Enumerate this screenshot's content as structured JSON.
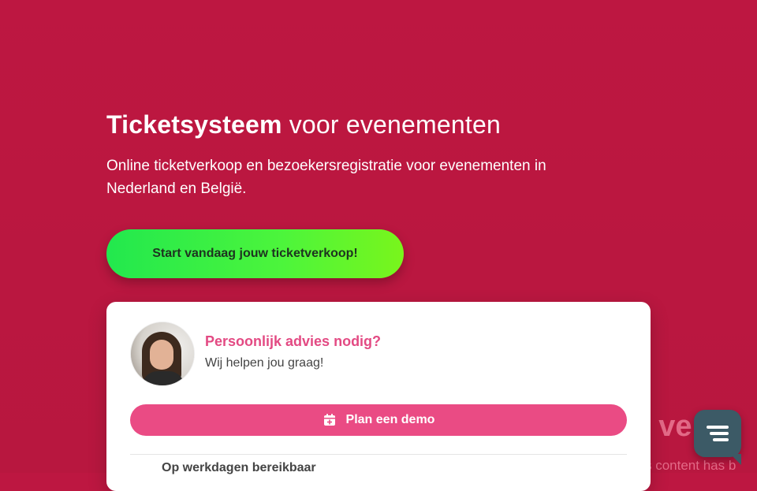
{
  "hero": {
    "title_bold": "Ticketsysteem",
    "title_rest": " voor evenementen",
    "subtitle": "Online ticketverkoop en bezoekersregistratie voor evenementen in Nederland en België.",
    "cta_label": "Start vandaag jouw ticketverkoop!"
  },
  "advice_card": {
    "title": "Persoonlijk advies nodig?",
    "subtitle": "Wij helpen jou graag!",
    "demo_button_label": "Plan een demo",
    "demo_icon": "calendar-plus-icon",
    "hours_heading": "Op werkdagen bereikbaar"
  },
  "background": {
    "heading_fragment": "t ve  y",
    "sub_fragment": "s content has b"
  },
  "chat": {
    "icon": "chat-lines-icon"
  },
  "colors": {
    "background": "#bd1741",
    "accent_pink": "#ea4b84",
    "cta_green": "#4df53b",
    "chat": "#3c5a66"
  }
}
